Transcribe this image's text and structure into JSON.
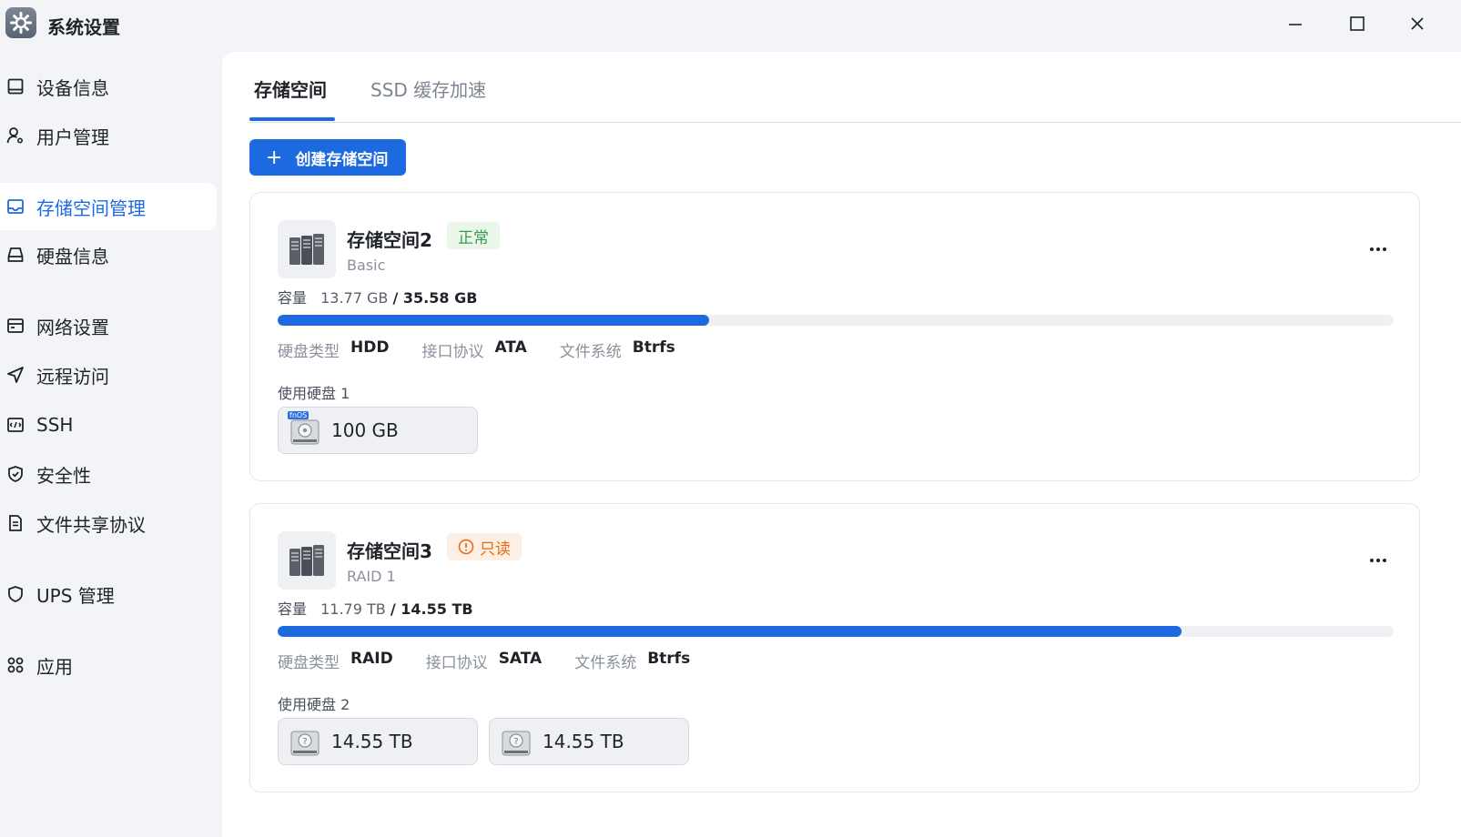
{
  "window": {
    "title": "系统设置",
    "controls": [
      "minimize",
      "maximize",
      "close"
    ]
  },
  "sidebar": {
    "items": [
      {
        "label": "设备信息",
        "icon": "monitor-icon",
        "active": false
      },
      {
        "label": "用户管理",
        "icon": "user-gear-icon",
        "active": false
      },
      {
        "label": "存储空间管理",
        "icon": "storage-icon",
        "active": true
      },
      {
        "label": "硬盘信息",
        "icon": "drive-icon",
        "active": false
      },
      {
        "label": "网络设置",
        "icon": "network-icon",
        "active": false
      },
      {
        "label": "远程访问",
        "icon": "send-icon",
        "active": false
      },
      {
        "label": "SSH",
        "icon": "terminal-icon",
        "active": false
      },
      {
        "label": "安全性",
        "icon": "shield-check-icon",
        "active": false
      },
      {
        "label": "文件共享协议",
        "icon": "document-icon",
        "active": false
      },
      {
        "label": "UPS 管理",
        "icon": "shield-icon",
        "active": false
      },
      {
        "label": "应用",
        "icon": "apps-icon",
        "active": false
      }
    ]
  },
  "tabs": [
    {
      "label": "存储空间",
      "active": true
    },
    {
      "label": "SSD 缓存加速",
      "active": false
    }
  ],
  "create_button": {
    "label": "创建存储空间",
    "icon": "plus-icon"
  },
  "labels": {
    "capacity": "容量",
    "disk_type": "硬盘类型",
    "interface": "接口协议",
    "filesystem": "文件系统"
  },
  "pools": [
    {
      "name": "存储空间2",
      "status": "正常",
      "status_type": "ok",
      "level": "Basic",
      "used": "13.77 GB",
      "total": "/ 35.58 GB",
      "usage_fraction": 0.387,
      "disk_type": "HDD",
      "interface": "ATA",
      "filesystem": "Btrfs",
      "disks_title": "使用硬盘 1",
      "disks": [
        {
          "size": "100 GB",
          "tag": "fnOS"
        }
      ]
    },
    {
      "name": "存储空间3",
      "status": "只读",
      "status_type": "warn",
      "level": "RAID 1",
      "used": "11.79 TB",
      "total": "/ 14.55 TB",
      "usage_fraction": 0.81,
      "disk_type": "RAID",
      "interface": "SATA",
      "filesystem": "Btrfs",
      "disks_title": "使用硬盘 2",
      "disks": [
        {
          "size": "14.55 TB"
        },
        {
          "size": "14.55 TB"
        }
      ]
    }
  ],
  "colors": {
    "accent": "#1d6ae0",
    "ok": "#3b9a4a",
    "warn": "#e86b1a",
    "sidebar_bg": "#f2f4f8"
  }
}
